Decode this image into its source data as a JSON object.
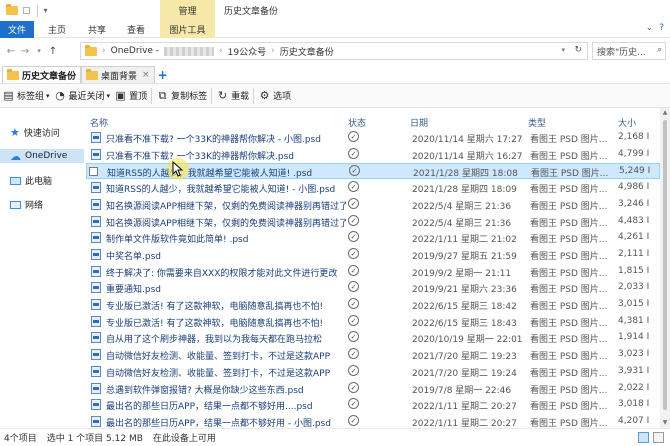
{
  "window": {
    "manage_tab": "管理",
    "title": "历史文章备份"
  },
  "ribbon": {
    "tabs": [
      "文件",
      "主页",
      "共享",
      "查看",
      "图片工具"
    ]
  },
  "address": {
    "root": "OneDrive -",
    "segment1": "19公众号",
    "segment2": "历史文章备份",
    "search_placeholder": "搜索\"历史..."
  },
  "folder_tabs": [
    {
      "label": "历史文章备份"
    },
    {
      "label": "桌面背景"
    }
  ],
  "toolbar": {
    "items": [
      "标签组",
      "最近关闭",
      "置顶",
      "复制标签",
      "重载",
      "选项"
    ]
  },
  "nav": {
    "items": [
      "快速访问",
      "OneDrive",
      "此电脑",
      "网络"
    ]
  },
  "columns": {
    "name": "名称",
    "status": "状态",
    "date": "日期",
    "type": "类型",
    "size": "大小"
  },
  "files": [
    {
      "name": "只准看不准下载? 一个33K的神器帮你解决 - 小图.psd",
      "date": "2020/11/14 星期六 17:27",
      "type": "看图王 PSD 图片...",
      "size": "2,168 I"
    },
    {
      "name": "只准看不准下载? 一个33K的神器帮你解决.psd",
      "date": "2020/11/14 星期六 16:27",
      "type": "看图王 PSD 图片...",
      "size": "4,799 I"
    },
    {
      "name": "知道RSS的人越少，我就越希望它能被人知道! .psd",
      "date": "2021/1/28 星期四 18:08",
      "type": "看图王 PSD 图片...",
      "size": "5,249 I",
      "selected": true
    },
    {
      "name": "知道RSS的人越少，我就越希望它能被人知道! - 小图.psd",
      "date": "2021/1/28 星期四 18:09",
      "type": "看图王 PSD 图片...",
      "size": "4,986 I"
    },
    {
      "name": "知名换源阅读APP相继下架，仅剩的免费阅读神器别再错过了",
      "date": "2022/5/4 星期三 21:36",
      "type": "看图王 PSD 图片...",
      "size": "3,246 I"
    },
    {
      "name": "知名换源阅读APP相继下架，仅剩的免费阅读神器别再错过了",
      "date": "2022/5/4 星期三 21:36",
      "type": "看图王 PSD 图片...",
      "size": "4,483 I"
    },
    {
      "name": "制作单文件版软件竟如此简单! .psd",
      "date": "2022/1/11 星期二 21:02",
      "type": "看图王 PSD 图片...",
      "size": "4,261 I"
    },
    {
      "name": "中奖名单.psd",
      "date": "2019/9/27 星期五 21:59",
      "type": "看图王 PSD 图片...",
      "size": "2,111 I"
    },
    {
      "name": "终于解决了: 你需要来自XXX的权限才能对此文件进行更改",
      "date": "2019/9/2 星期一 21:11",
      "type": "看图王 PSD 图片...",
      "size": "1,815 I"
    },
    {
      "name": "重要通知.psd",
      "date": "2019/9/21 星期六 23:36",
      "type": "看图王 PSD 图片...",
      "size": "2,033 I"
    },
    {
      "name": "专业版已激活! 有了这款神软，电脑随意乱搞再也不怕!",
      "date": "2022/6/15 星期三 18:42",
      "type": "看图王 PSD 图片...",
      "size": "3,015 I"
    },
    {
      "name": "专业版已激活! 有了这款神软，电脑随意乱搞再也不怕!",
      "date": "2022/6/15 星期三 18:43",
      "type": "看图王 PSD 图片...",
      "size": "4,381 I"
    },
    {
      "name": "自从用了这个刷步神器，我到以为我每天都在跑马拉松",
      "date": "2020/10/19 星期一 22:01",
      "type": "看图王 PSD 图片...",
      "size": "1,914 I"
    },
    {
      "name": "自动微信好友检测、收能量、签到打卡，不过是这款APP",
      "date": "2021/7/20 星期二 19:23",
      "type": "看图王 PSD 图片...",
      "size": "3,023 I"
    },
    {
      "name": "自动微信好友检测、收能量、签到打卡，不过是这款APP",
      "date": "2021/7/20 星期二 19:24",
      "type": "看图王 PSD 图片...",
      "size": "3,931 I"
    },
    {
      "name": "总遇到软件弹窗报错? 大概是你缺少这些东西.psd",
      "date": "2019/7/8 星期一 22:46",
      "type": "看图王 PSD 图片...",
      "size": "2,022 I"
    },
    {
      "name": "最出名的那些日历APP，结果一点都不够好用....psd",
      "date": "2022/1/11 星期二 20:27",
      "type": "看图王 PSD 图片...",
      "size": "3,018 I"
    },
    {
      "name": "最出名的那些日历APP，结果一点都不够好用 - 小图.psd",
      "date": "2022/1/11 星期二 20:27",
      "type": "看图王 PSD 图片...",
      "size": "4,207 I"
    }
  ],
  "statusbar": {
    "count": "4个项目",
    "selected": "选中 1 个项目  5.12 MB",
    "availability": "在此设备上可用"
  }
}
